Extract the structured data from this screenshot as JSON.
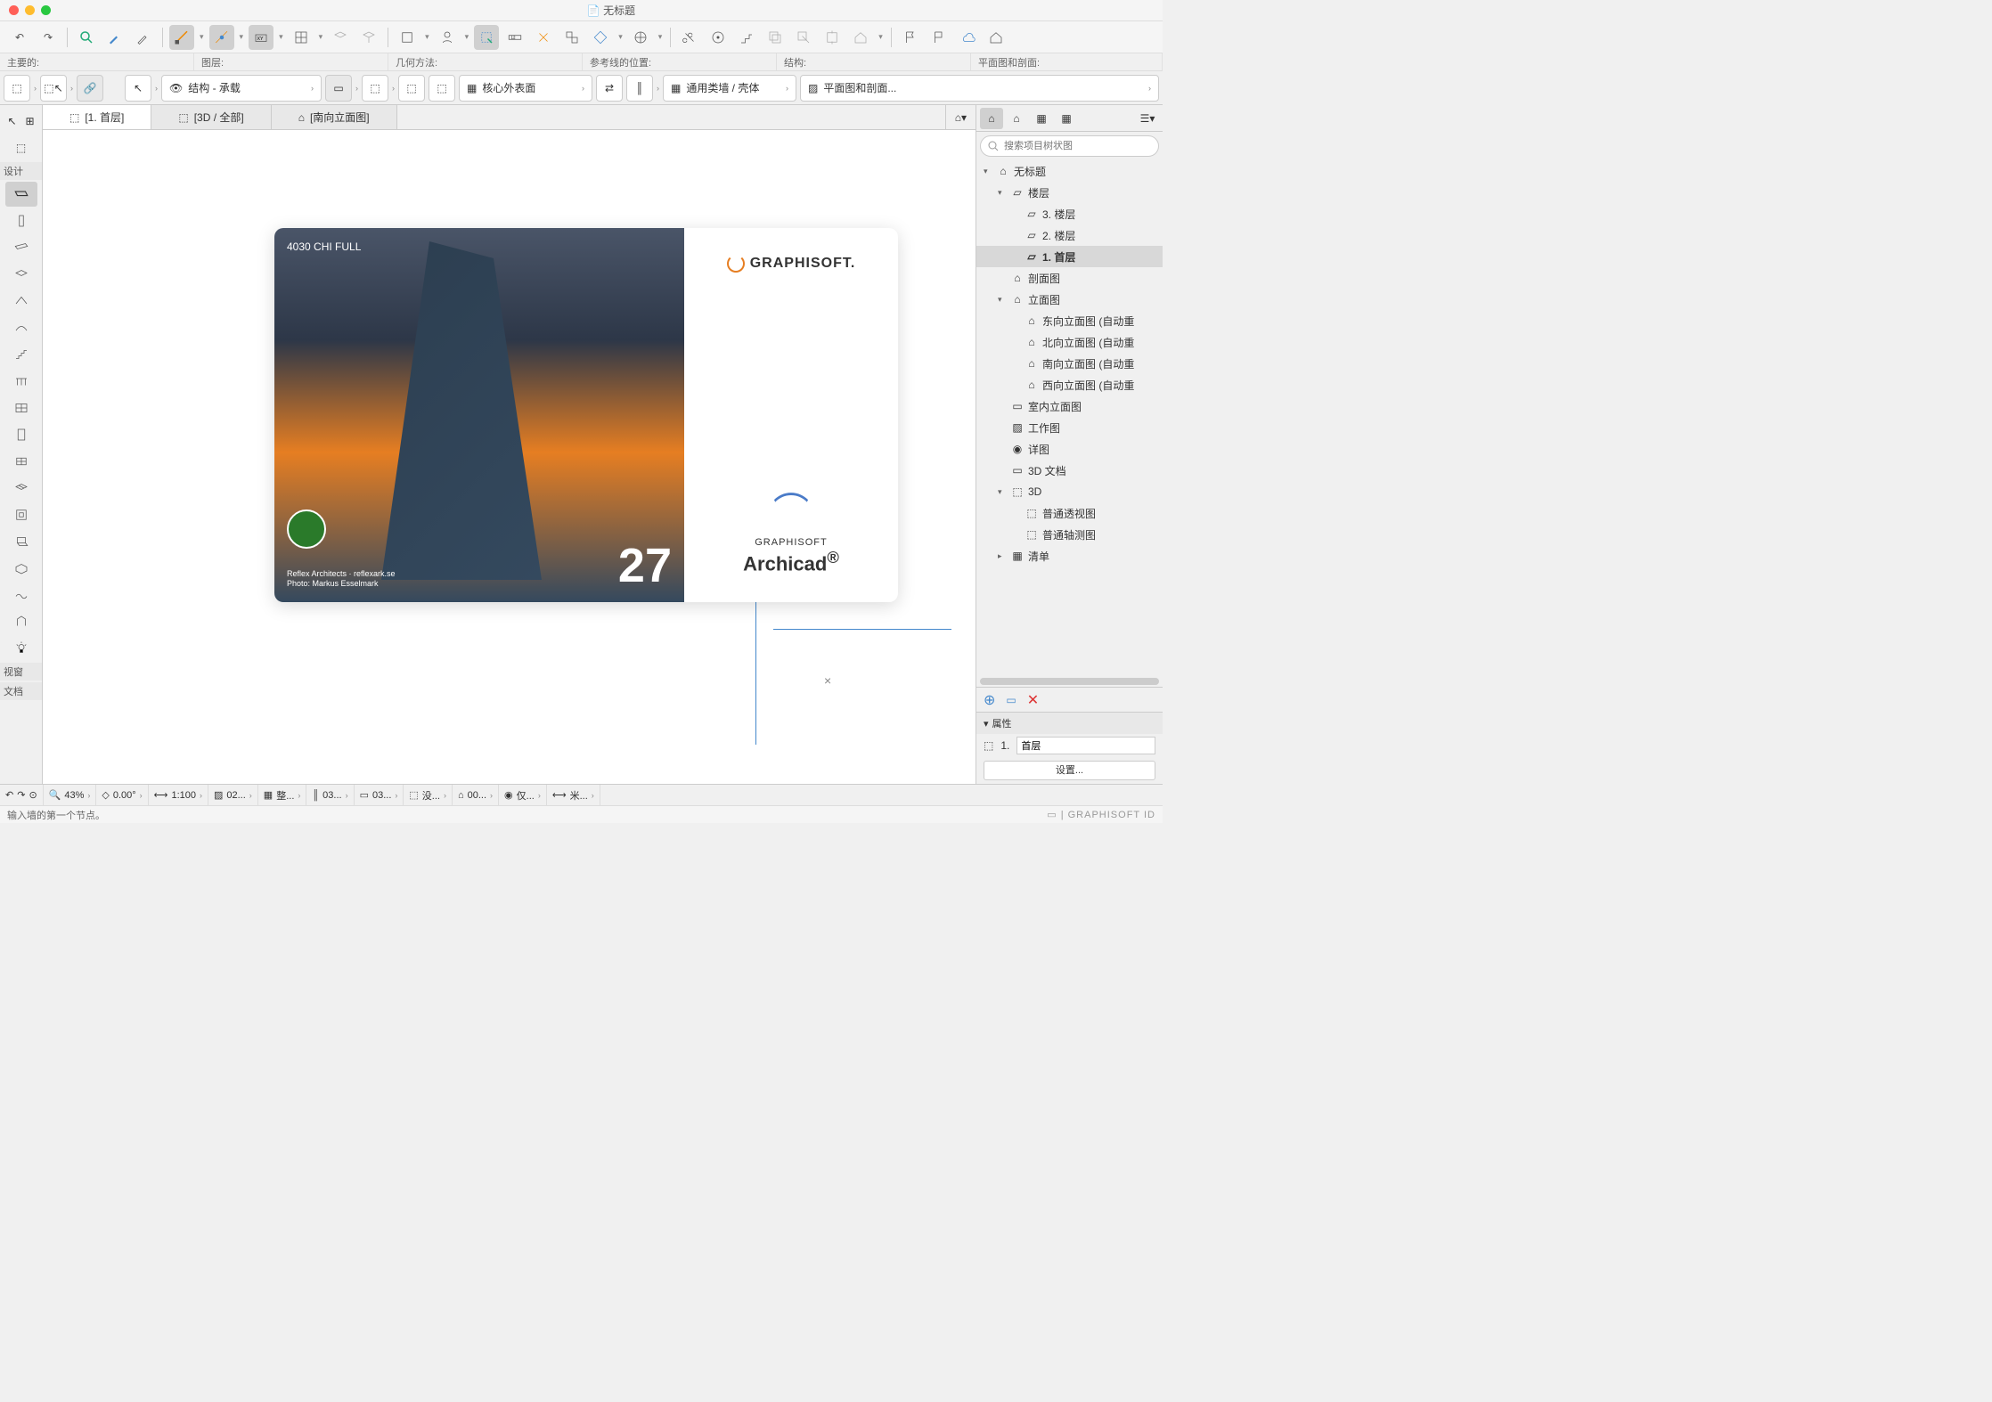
{
  "title": "无标题",
  "labels": {
    "main": "主要的:",
    "layer": "图层:",
    "geom": "几何方法:",
    "refline": "参考线的位置:",
    "struct": "结构:",
    "plan": "平面图和剖面:"
  },
  "controls": {
    "layer": "结构 - 承载",
    "refline": "核心外表面",
    "struct": "通用类墙 / 壳体",
    "plan": "平面图和剖面..."
  },
  "tabs": {
    "t1": "[1. 首层]",
    "t2": "[3D / 全部]",
    "t3": "[南向立面图]"
  },
  "splash": {
    "label": "4030 CHI FULL",
    "version": "27",
    "brand": "GRAPHISOFT.",
    "product_top": "GRAPHISOFT",
    "product": "Archicad",
    "credit1": "Reflex Architects · reflexark.se",
    "credit2": "Photo: Markus Esselmark"
  },
  "search_ph": "搜索项目树状图",
  "tree": [
    {
      "d": 0,
      "tw": "▾",
      "ic": "home",
      "t": "无标题"
    },
    {
      "d": 1,
      "tw": "▾",
      "ic": "story",
      "t": "楼层"
    },
    {
      "d": 2,
      "tw": "",
      "ic": "story",
      "t": "3. 楼层"
    },
    {
      "d": 2,
      "tw": "",
      "ic": "story",
      "t": "2. 楼层"
    },
    {
      "d": 2,
      "tw": "",
      "ic": "story",
      "t": "1. 首层",
      "sel": true
    },
    {
      "d": 1,
      "tw": "",
      "ic": "sec",
      "t": "剖面图"
    },
    {
      "d": 1,
      "tw": "▾",
      "ic": "elev",
      "t": "立面图"
    },
    {
      "d": 2,
      "tw": "",
      "ic": "elev",
      "t": "东向立面图 (自动重"
    },
    {
      "d": 2,
      "tw": "",
      "ic": "elev",
      "t": "北向立面图 (自动重"
    },
    {
      "d": 2,
      "tw": "",
      "ic": "elev",
      "t": "南向立面图 (自动重"
    },
    {
      "d": 2,
      "tw": "",
      "ic": "elev",
      "t": "西向立面图 (自动重"
    },
    {
      "d": 1,
      "tw": "",
      "ic": "int",
      "t": "室内立面图"
    },
    {
      "d": 1,
      "tw": "",
      "ic": "ws",
      "t": "工作图"
    },
    {
      "d": 1,
      "tw": "",
      "ic": "det",
      "t": "详图"
    },
    {
      "d": 1,
      "tw": "",
      "ic": "3dd",
      "t": "3D 文档"
    },
    {
      "d": 1,
      "tw": "▾",
      "ic": "3d",
      "t": "3D"
    },
    {
      "d": 2,
      "tw": "",
      "ic": "3d",
      "t": "普通透视图"
    },
    {
      "d": 2,
      "tw": "",
      "ic": "3d",
      "t": "普通轴测图"
    },
    {
      "d": 1,
      "tw": "▸",
      "ic": "sch",
      "t": "清单"
    }
  ],
  "props": {
    "hdr": "属性",
    "k": "1.",
    "v": "首层",
    "btn": "设置..."
  },
  "ltool_sections": {
    "design": "设计",
    "viewport": "视窗",
    "doc": "文档"
  },
  "status": {
    "zoom": "43%",
    "angle": "0.00°",
    "scale": "1:100",
    "s1": "02...",
    "s2": "整...",
    "s3": "03...",
    "s4": "03...",
    "s5": "没...",
    "s6": "00...",
    "s7": "仅...",
    "s8": "米..."
  },
  "hint": "输入墙的第一个节点。",
  "footer_brand": "GRAPHISOFT ID"
}
